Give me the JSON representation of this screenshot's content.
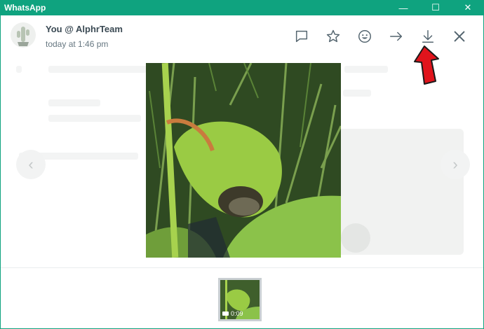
{
  "window": {
    "title": "WhatsApp",
    "controls": {
      "minimize": "—",
      "maximize": "☐",
      "close": "✕"
    }
  },
  "header": {
    "sender": "You @ AlphrTeam",
    "timestamp": "today at 1:46 pm",
    "actions": [
      "reply-icon",
      "star-icon",
      "emoji-icon",
      "forward-icon",
      "download-icon",
      "close-icon"
    ]
  },
  "thumbnail": {
    "duration": "0:09"
  },
  "nav": {
    "prev": "‹",
    "next": "›"
  },
  "colors": {
    "brand": "#0fa37f",
    "pointer": "#e0141c",
    "icon": "#54656f"
  }
}
